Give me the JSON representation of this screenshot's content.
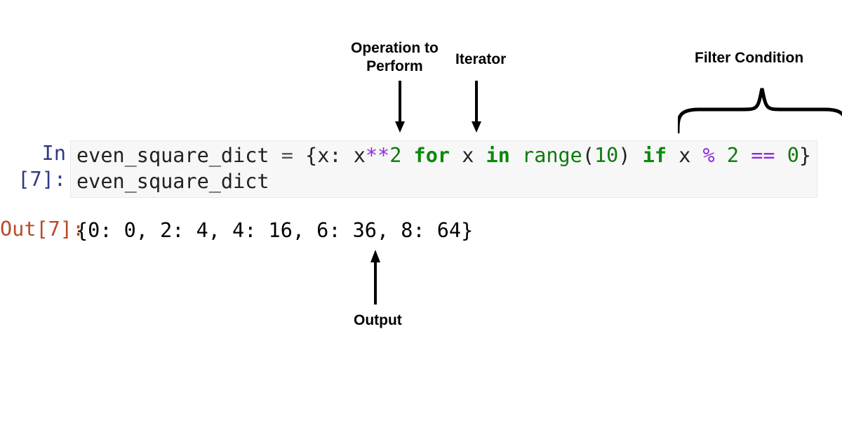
{
  "cell": {
    "in_prompt": "In [7]:",
    "out_prompt": "Out[7]:",
    "code_tokens": {
      "name1": "even_square_dict",
      "assign": " = ",
      "lbrace": "{",
      "key": "x",
      "colon": ": ",
      "valx": "x",
      "star": "**",
      "two": "2",
      "sp1": " ",
      "for": "for",
      "sp2": " ",
      "itvar": "x",
      "sp3": " ",
      "in": "in",
      "sp4": " ",
      "range": "range",
      "lpar": "(",
      "ten": "10",
      "rpar": ")",
      "sp5": " ",
      "if": "if",
      "sp6": " ",
      "condx": "x",
      "sp7": " ",
      "mod": "%",
      "sp8": " ",
      "two2": "2",
      "sp9": " ",
      "eqeq": "==",
      "sp10": " ",
      "zero": "0",
      "rbrace": "}"
    },
    "code_line2": "even_square_dict",
    "output": "{0: 0, 2: 4, 4: 16, 6: 36, 8: 64}"
  },
  "labels": {
    "operation": "Operation to\nPerform",
    "iterator": "Iterator",
    "filter": "Filter Condition",
    "output": "Output"
  }
}
